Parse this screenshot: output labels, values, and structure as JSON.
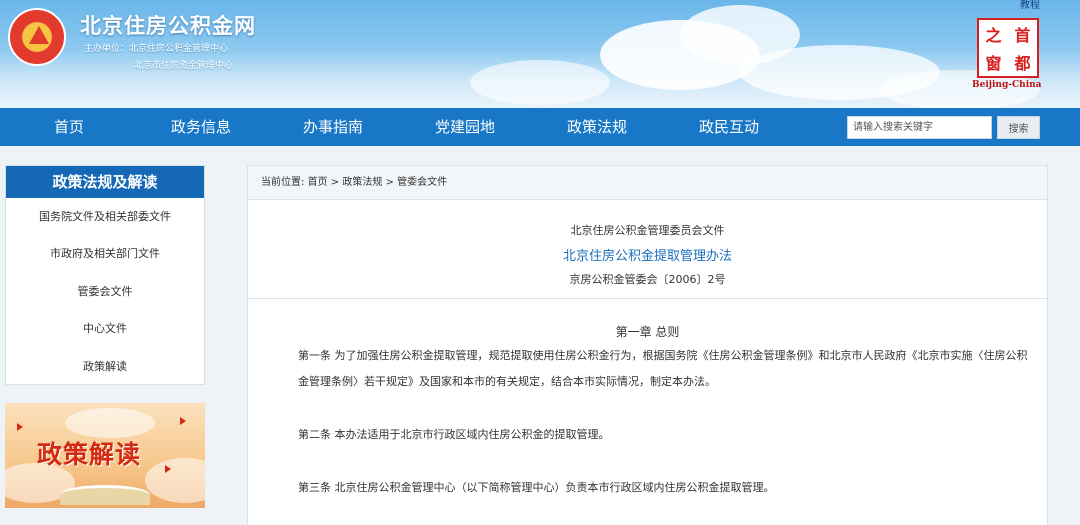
{
  "header": {
    "site_title": "北京住房公积金网",
    "host_line1": "主办单位：北京住房公积金管理中心",
    "host_line2": "北京市住房资金管理中心",
    "top_link": "教程",
    "seal_chars": [
      "之",
      "首",
      "窗",
      "都"
    ],
    "seal_caption": "Beijing-China"
  },
  "nav": {
    "items": [
      {
        "label": "首页"
      },
      {
        "label": "政务信息"
      },
      {
        "label": "办事指南"
      },
      {
        "label": "党建园地"
      },
      {
        "label": "政策法规"
      },
      {
        "label": "政民互动"
      }
    ],
    "search_placeholder": "请输入搜索关键字",
    "search_button": "搜索"
  },
  "sidebar": {
    "title": "政策法规及解读",
    "items": [
      {
        "label": "国务院文件及相关部委文件"
      },
      {
        "label": "市政府及相关部门文件"
      },
      {
        "label": "管委会文件"
      },
      {
        "label": "中心文件"
      },
      {
        "label": "政策解读"
      }
    ],
    "promo_title": "政策解读"
  },
  "breadcrumb": {
    "prefix": "当前位置:",
    "home": "首页",
    "sep": ">",
    "section": "政策法规",
    "current": "管委会文件"
  },
  "document": {
    "issuer": "北京住房公积金管理委员会文件",
    "title": "北京住房公积金提取管理办法",
    "number": "京房公积金管委会〔2006〕2号",
    "chapter": "第一章 总则",
    "articles": [
      "第一条 为了加强住房公积金提取管理，规范提取使用住房公积金行为，根据国务院《住房公积金管理条例》和北京市人民政府《北京市实施〈住房公积金管理条例〉若干规定》及国家和本市的有关规定，结合本市实际情况，制定本办法。",
      "第二条 本办法适用于北京市行政区域内住房公积金的提取管理。",
      "第三条 北京住房公积金管理中心（以下简称管理中心）负责本市行政区域内住房公积金提取管理。"
    ]
  },
  "colors": {
    "nav_bg": "#1877c6",
    "sidebar_head_bg": "#1568b5",
    "doc_title": "#1a6fbf",
    "seal_red": "#d81e1e"
  }
}
